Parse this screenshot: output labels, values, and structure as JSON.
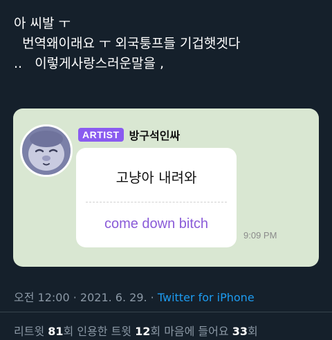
{
  "tweet": {
    "line1": "아 씨발 ㅜ",
    "line2": "  번역왜이래요 ㅜ 외국퉁프들 기겁햇겟다",
    "line3": "..   이렇게사랑스러운말을 ,"
  },
  "card": {
    "badge": "ARTIST",
    "name": "방구석인싸",
    "message_ko": "고냥아 내려와",
    "message_en": "come down bitch",
    "time": "9:09 PM"
  },
  "meta": {
    "time": "오전 12:00",
    "sep1": " · ",
    "date": "2021. 6. 29.",
    "sep2": " · ",
    "source": "Twitter for iPhone"
  },
  "stats": {
    "retweets_label": "리트윗 ",
    "retweets": "81",
    "retweets_unit": "회  ",
    "quotes_label": "인용한 트윗 ",
    "quotes": "12",
    "quotes_unit": "회  ",
    "likes_label": "마음에 들어요 ",
    "likes": "33",
    "likes_unit": "회"
  },
  "colors": {
    "background": "#15202b",
    "card": "#d9e7d2",
    "badge": "#8a5bf0",
    "translation": "#8a5bd8",
    "link": "#1d9bf0"
  }
}
